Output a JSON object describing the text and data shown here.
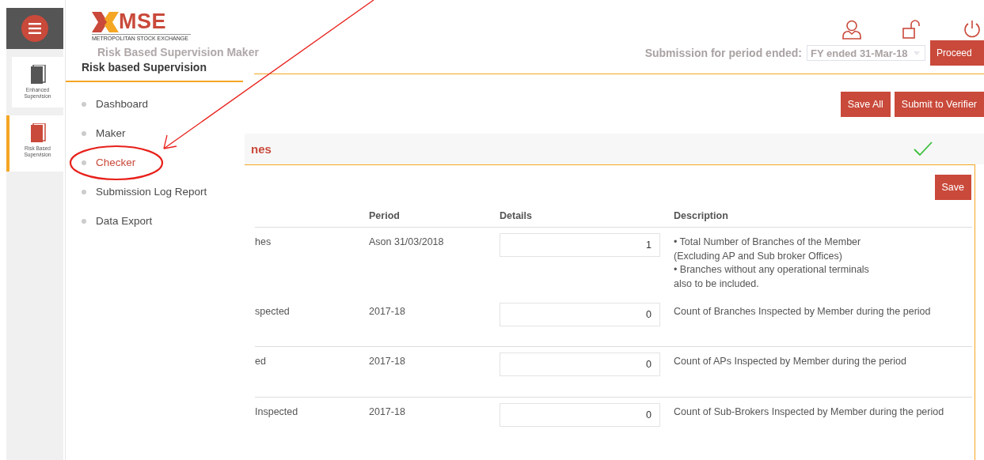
{
  "rail": {
    "items": [
      {
        "label": "Enhanced Supervision",
        "selected": false
      },
      {
        "label": "Risk Based Supervision",
        "selected": true
      }
    ]
  },
  "logo": {
    "name": "MSE",
    "tagline": "METROPOLITAN STOCK EXCHANGE"
  },
  "header": {
    "title": "Risk Based Supervision Maker",
    "period_label": "Submission for period ended:",
    "period_value": "FY ended 31-Mar-18",
    "proceed": "Proceed"
  },
  "menu": {
    "heading": "Risk based Supervision",
    "items": [
      {
        "label": "Dashboard",
        "selected": false
      },
      {
        "label": "Maker",
        "selected": false
      },
      {
        "label": "Checker",
        "selected": true
      },
      {
        "label": "Submission Log Report",
        "selected": false
      },
      {
        "label": "Data Export",
        "selected": false
      }
    ]
  },
  "actions": [
    "Save All",
    "Submit to Verifier"
  ],
  "section": {
    "title": "nes",
    "complete": true,
    "save": "Save"
  },
  "table": {
    "columns": [
      "Period",
      "Details",
      "Description"
    ],
    "rows": [
      {
        "column_1": "hes",
        "period": "Ason 31/03/2018",
        "details": "1",
        "description": [
          "• Total Number of Branches of the Member",
          "(Excluding AP and Sub broker Offices)",
          "• Branches without any operational terminals",
          "also to be included."
        ]
      },
      {
        "column_1": "spected",
        "period": "2017-18",
        "details": "0",
        "description": [
          "Count of Branches Inspected by Member during the period"
        ]
      },
      {
        "column_1": "ed",
        "period": "2017-18",
        "details": "0",
        "description": [
          "Count of APs Inspected by Member during the period"
        ]
      },
      {
        "column_1": "Inspected",
        "period": "2017-18",
        "details": "0",
        "description": [
          "Count of Sub-Brokers Inspected by Member during the period"
        ]
      }
    ]
  }
}
